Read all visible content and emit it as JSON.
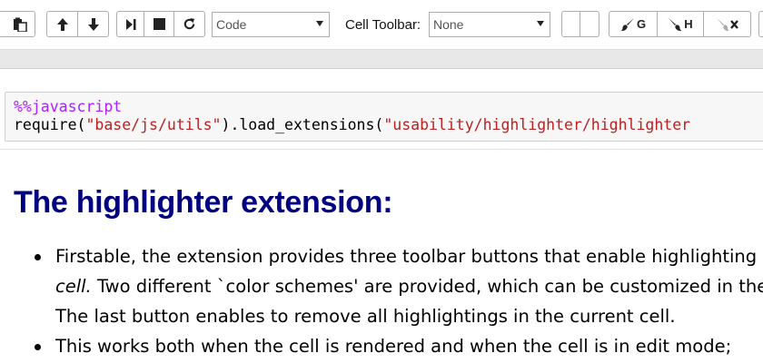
{
  "toolbar": {
    "cell_type_select": {
      "value": "Code"
    },
    "cell_toolbar_label": "Cell Toolbar:",
    "cell_toolbar_select": {
      "value": "None"
    },
    "highlighter_buttons": [
      {
        "letter": "G",
        "icon": "brush-icon"
      },
      {
        "letter": "H",
        "icon": "brush-icon"
      },
      {
        "letter": "",
        "icon": "eraser-icon"
      }
    ]
  },
  "code_cell": {
    "magic": "%%javascript",
    "line2": {
      "fn": "require",
      "arg1": "\"base/js/utils\"",
      "method": ".load_extensions",
      "arg2": "\"usability/highlighter/highlighter"
    }
  },
  "markdown": {
    "heading": "The highlighter extension:",
    "bullets": [
      {
        "line1": "Firstable, the extension provides three toolbar buttons that enable highlighting a s",
        "line2_em": "cell.",
        "line2_rest": " Two different `color schemes' are provided, which can be customized in the",
        "line3": "The last button enables to remove all highlightings in the current cell."
      },
      {
        "line1": "This works both when the cell is rendered and when the cell is in edit mode;"
      }
    ]
  },
  "colors": {
    "heading": "#000080",
    "magic": "#aa22ff",
    "string": "#ba2121",
    "code_bg": "#f7f7f7",
    "strip": "#e8e8e8"
  }
}
